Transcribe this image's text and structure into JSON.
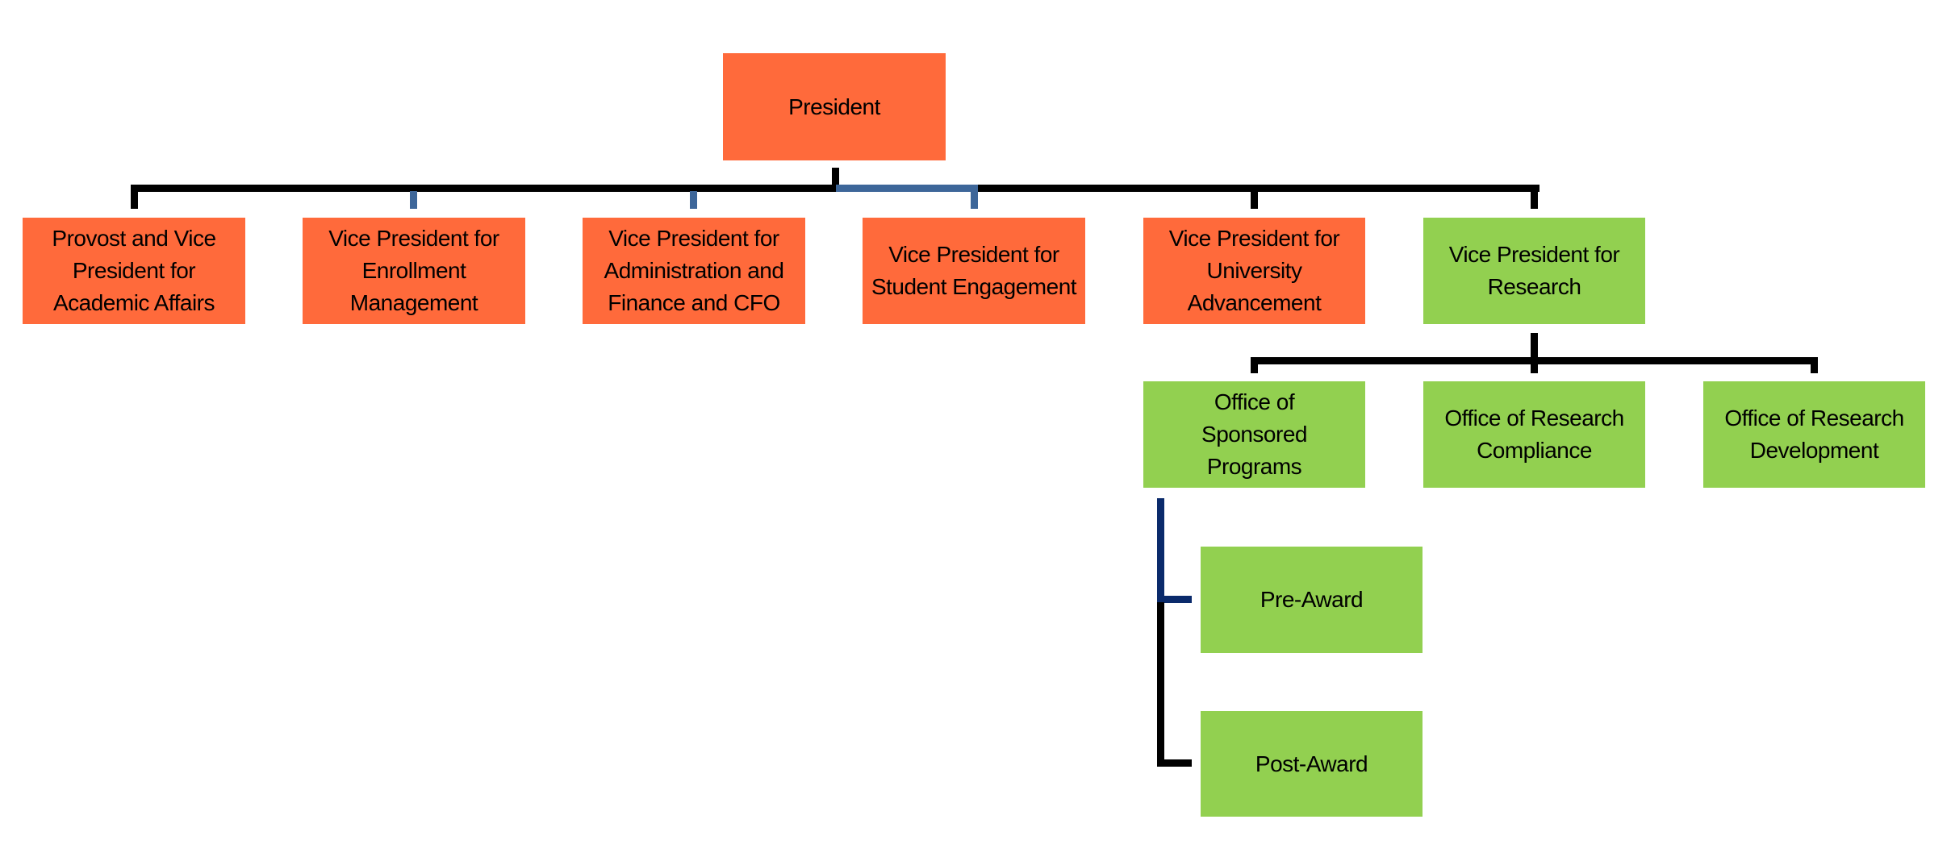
{
  "colors": {
    "orange": "#ff6a3b",
    "green": "#92d050",
    "connector": "#000000",
    "connector_blue": "#3d6699",
    "connector_navy": "#0a2a6b"
  },
  "president": {
    "label": "President"
  },
  "vice_presidents": [
    {
      "label": "Provost and Vice President for Academic Affairs"
    },
    {
      "label": "Vice President for Enrollment Management"
    },
    {
      "label": "Vice President for Administration and Finance and CFO"
    },
    {
      "label": "Vice President for Student Engagement"
    },
    {
      "label": "Vice President for University Advancement"
    },
    {
      "label": "Vice President for Research"
    }
  ],
  "research_offices": [
    {
      "label": "Office of Sponsored Programs"
    },
    {
      "label": "Office of Research Compliance"
    },
    {
      "label": "Office of Research Development"
    }
  ],
  "sponsored_programs_units": [
    {
      "label": "Pre-Award"
    },
    {
      "label": "Post-Award"
    }
  ]
}
